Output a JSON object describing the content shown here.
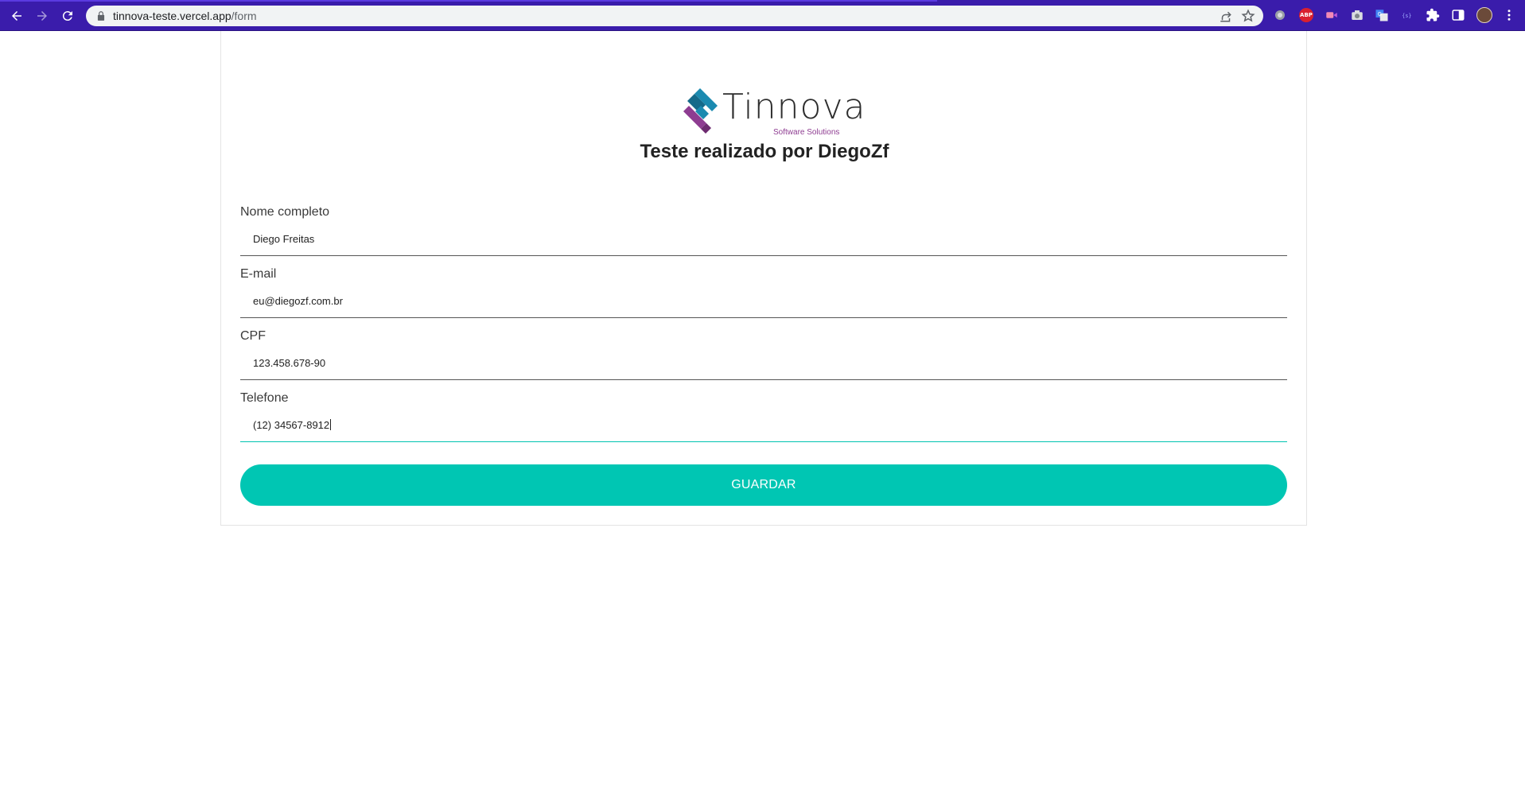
{
  "browser": {
    "url_host": "tinnova-teste.vercel.app",
    "url_path": "/form",
    "extensions": [
      "circle-icon",
      "abp-icon",
      "recorder-icon",
      "camera-icon",
      "translate-icon",
      "code-icon",
      "puzzle-icon",
      "sidepanel-icon",
      "profile-avatar"
    ],
    "abp_label": "ABP"
  },
  "logo": {
    "brand": "Tinnova",
    "tagline": "Software Solutions"
  },
  "page": {
    "title": "Teste realizado por DiegoZf"
  },
  "form": {
    "fields": [
      {
        "label": "Nome completo",
        "value": "Diego Freitas"
      },
      {
        "label": "E-mail",
        "value": "eu@diegozf.com.br"
      },
      {
        "label": "CPF",
        "value": "123.458.678-90"
      },
      {
        "label": "Telefone",
        "value": "(12) 34567-8912"
      }
    ],
    "submit_label": "GUARDAR"
  },
  "colors": {
    "accent": "#00c6b3",
    "chrome": "#3a1cab",
    "logo_purple": "#8e3c91",
    "logo_blue": "#1b8ab0"
  }
}
